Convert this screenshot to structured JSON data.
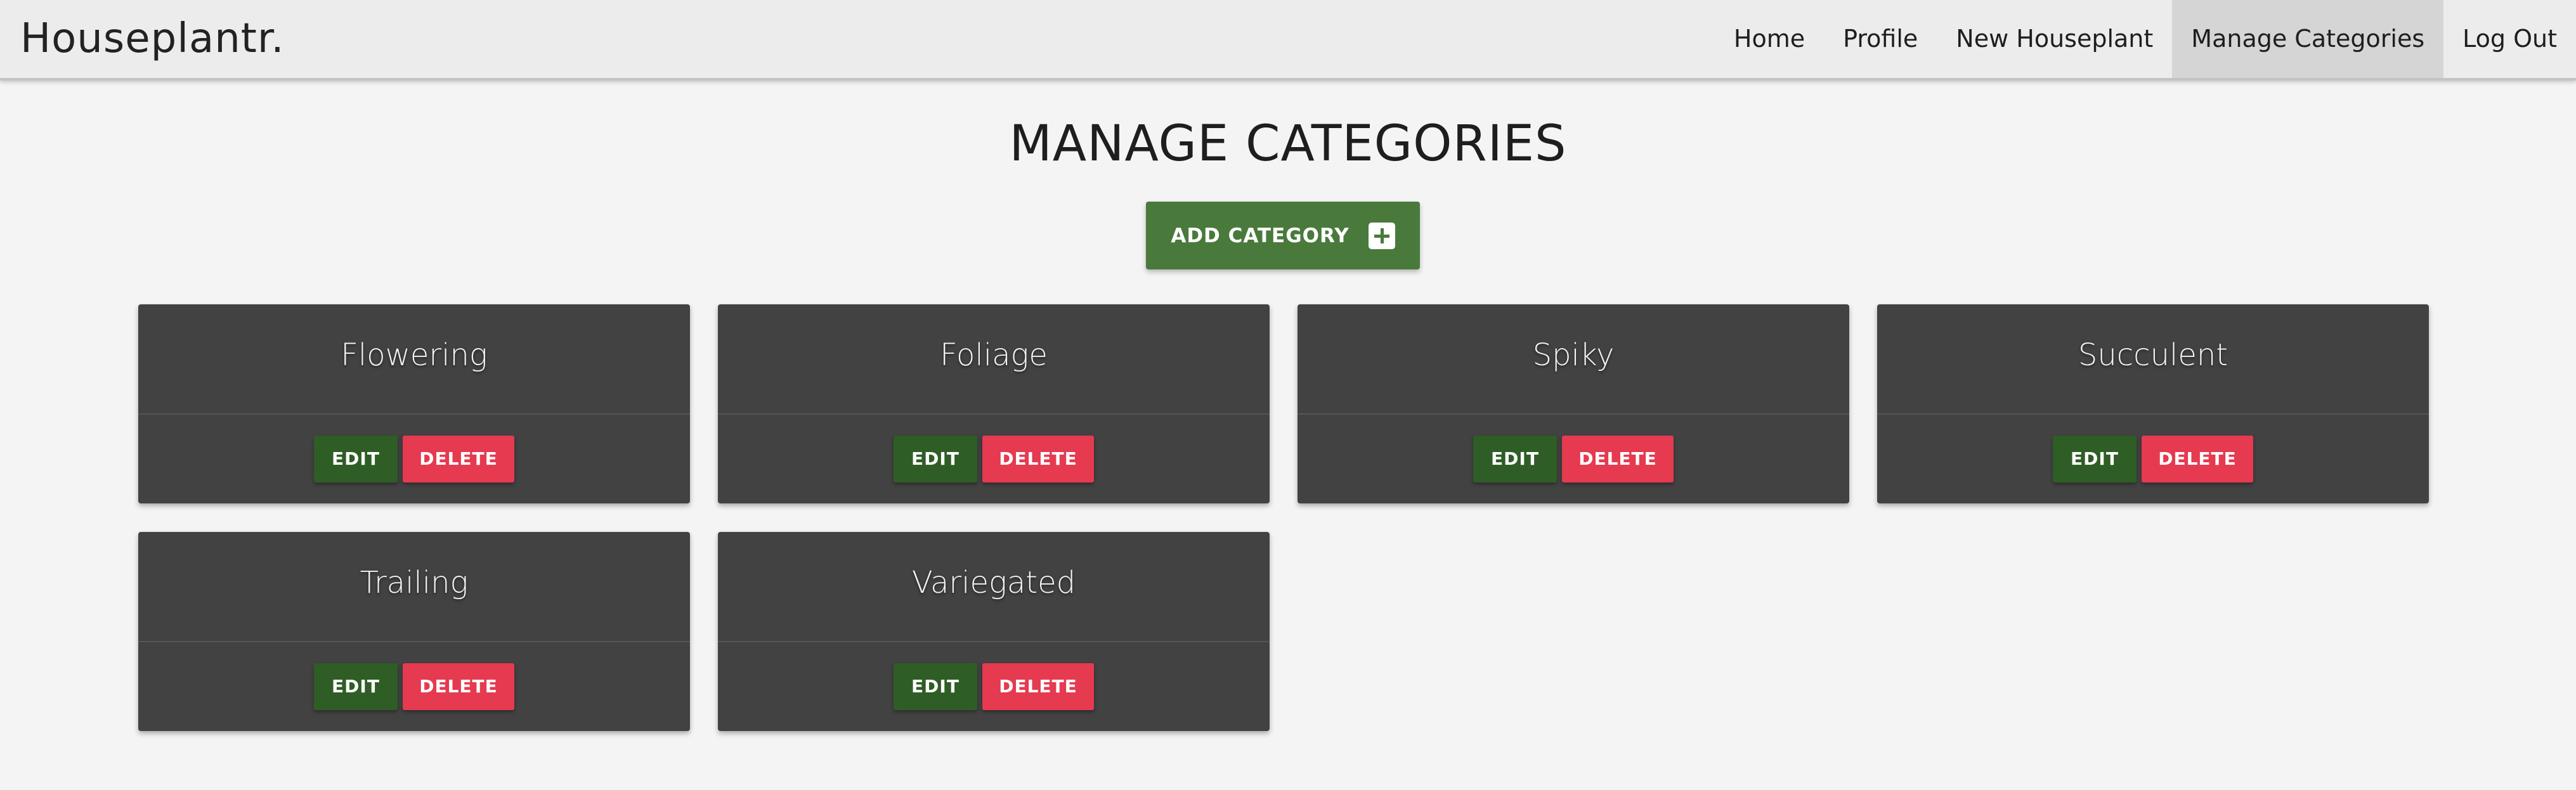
{
  "nav": {
    "brand": "Houseplantr.",
    "links": [
      "Home",
      "Profile",
      "New Houseplant",
      "Manage Categories",
      "Log Out"
    ],
    "active": "Manage Categories"
  },
  "page": {
    "title": "MANAGE CATEGORIES",
    "add_button": "ADD CATEGORY"
  },
  "categories": [
    {
      "name": "Flowering",
      "edit": "EDIT",
      "delete": "DELETE"
    },
    {
      "name": "Foliage",
      "edit": "EDIT",
      "delete": "DELETE"
    },
    {
      "name": "Spiky",
      "edit": "EDIT",
      "delete": "DELETE"
    },
    {
      "name": "Succulent",
      "edit": "EDIT",
      "delete": "DELETE"
    },
    {
      "name": "Trailing",
      "edit": "EDIT",
      "delete": "DELETE"
    },
    {
      "name": "Variegated",
      "edit": "EDIT",
      "delete": "DELETE"
    }
  ],
  "colors": {
    "primary_green": "#497a3c",
    "edit_green": "#2f5d26",
    "delete_red": "#e53a50",
    "card_bg": "#424242"
  },
  "icons": {
    "add": "plus-square-icon"
  }
}
